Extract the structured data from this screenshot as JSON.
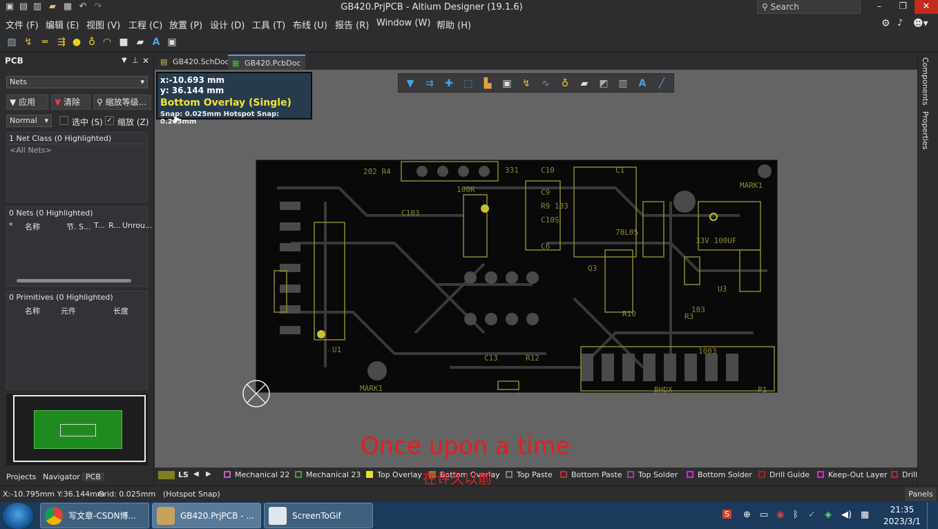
{
  "window": {
    "title": "GB420.PrjPCB - Altium Designer (19.1.6)",
    "search_placeholder": "Search"
  },
  "menu": [
    "文件 (F)",
    "编辑 (E)",
    "视图 (V)",
    "工程 (C)",
    "放置 (P)",
    "设计 (D)",
    "工具 (T)",
    "布线 (U)",
    "报告 (R)",
    "Window (W)",
    "帮助 (H)"
  ],
  "panel": {
    "title": "PCB",
    "mode": "Nets",
    "apply_label": "应用",
    "clear_label": "清除",
    "zoom_label": "缩放等级...",
    "normal_value": "Normal",
    "select_label": "选中 (S)",
    "zoom_check_label": "缩放 (Z)",
    "netclass_header": "1 Net Class (0 Highlighted)",
    "netclass_item": "<All Nets>",
    "nets_header": "0 Nets (0 Highlighted)",
    "nets_cols": [
      "*",
      "名称",
      "节. S...",
      "T...",
      "R...",
      "Unrou..."
    ],
    "prims_header": "0 Primitives (0 Highlighted)",
    "prims_cols": [
      "名称",
      "元件",
      "长度"
    ],
    "bottom_tabs": [
      "Projects",
      "Navigator",
      "PCB"
    ]
  },
  "doc_tabs": [
    {
      "label": "GB420.SchDoc"
    },
    {
      "label": "GB420.PcbDoc *"
    }
  ],
  "readout": {
    "x": "x:-10.693 mm",
    "y": "y: 36.144 mm",
    "layer": "Bottom Overlay (Single)",
    "snap": "Snap: 0.025mm Hotspot Snap: 0.203mm"
  },
  "caption": "Once upon a time",
  "subcaption": "在许久以前",
  "right_tabs": [
    "Components",
    "Properties"
  ],
  "layers": {
    "current": "LS",
    "items": [
      {
        "name": "Mechanical 22",
        "color": "#c060c0"
      },
      {
        "name": "Mechanical 23",
        "color": "#40a040"
      },
      {
        "name": "Top Overlay",
        "color": "#f0e020"
      },
      {
        "name": "Bottom Overlay",
        "color": "#808020"
      },
      {
        "name": "Top Paste",
        "color": "#808080"
      },
      {
        "name": "Bottom Paste",
        "color": "#c03030"
      },
      {
        "name": "Top Solder",
        "color": "#a040a0"
      },
      {
        "name": "Bottom Solder",
        "color": "#e020e0"
      },
      {
        "name": "Drill Guide",
        "color": "#b02020"
      },
      {
        "name": "Keep-Out Layer",
        "color": "#e020e0"
      },
      {
        "name": "Drill",
        "color": "#d02020"
      }
    ]
  },
  "status": {
    "coords": "X:-10.795mm Y:36.144mm",
    "grid": "Grid: 0.025mm",
    "snap": "(Hotspot Snap)",
    "panels": "Panels"
  },
  "taskbar": {
    "tasks": [
      "写文章-CSDN博...",
      "GB420.PrjPCB - ...",
      "ScreenToGif"
    ],
    "time": "21:35",
    "date": "2023/3/1"
  }
}
